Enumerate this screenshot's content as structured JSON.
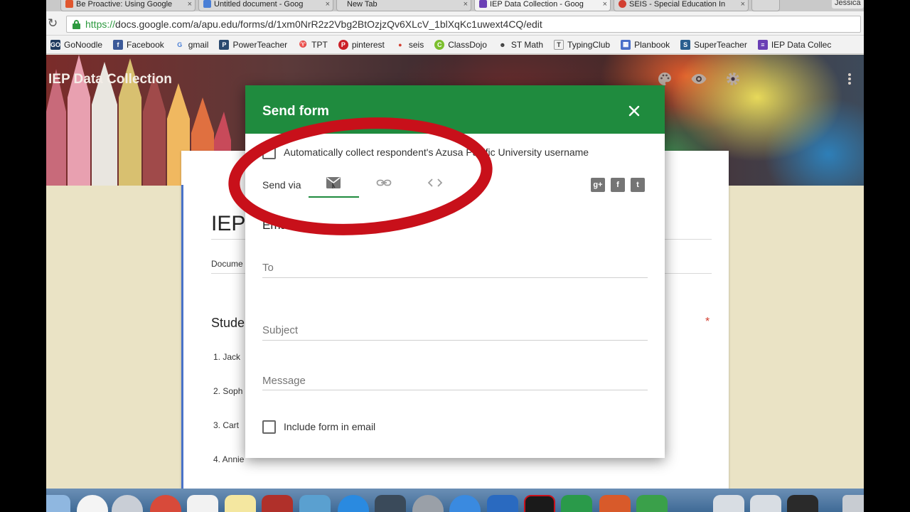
{
  "browser": {
    "tabs": [
      {
        "label": "Be Proactive: Using Google",
        "favicon_color": "#e0562e",
        "active": false
      },
      {
        "label": "Untitled document - Goog",
        "favicon_color": "#4a7fd6",
        "active": false
      },
      {
        "label": "New Tab",
        "favicon_color": "",
        "active": false
      },
      {
        "label": "IEP Data Collection - Goog",
        "favicon_color": "#6a3fb5",
        "active": true
      },
      {
        "label": "SEIS - Special Education In",
        "favicon_color": "#d23f31",
        "active": false
      }
    ],
    "tab_close_glyph": "×",
    "profile_name": "Jessica",
    "url_scheme": "https://",
    "url_rest": "docs.google.com/a/apu.edu/forms/d/1xm0NrR2z2Vbg2BtOzjzQv6XLcV_1blXqKc1uwext4CQ/edit",
    "bookmarks": [
      {
        "label": "GoNoodle",
        "icon_color": "#1f3a5f",
        "icon_text": "GO"
      },
      {
        "label": "Facebook",
        "icon_color": "#3b5998",
        "icon_text": "f"
      },
      {
        "label": "gmail",
        "icon_color": "#ffffff",
        "icon_text": "G"
      },
      {
        "label": "PowerTeacher",
        "icon_color": "#2b4a6f",
        "icon_text": "P"
      },
      {
        "label": "TPT",
        "icon_color": "#ffffff",
        "icon_text": "♈"
      },
      {
        "label": "pinterest",
        "icon_color": "#cb2027",
        "icon_text": "P"
      },
      {
        "label": "seis",
        "icon_color": "#d23f31",
        "icon_text": "●"
      },
      {
        "label": "ClassDojo",
        "icon_color": "#7cbf2e",
        "icon_text": "C"
      },
      {
        "label": "ST Math",
        "icon_color": "#333333",
        "icon_text": "☻"
      },
      {
        "label": "TypingClub",
        "icon_color": "#ffffff",
        "icon_text": "T"
      },
      {
        "label": "Planbook",
        "icon_color": "#4a6fc9",
        "icon_text": "▦"
      },
      {
        "label": "SuperTeacher",
        "icon_color": "#2a5f8f",
        "icon_text": "S"
      },
      {
        "label": "IEP Data Collec",
        "icon_color": "#6a3fb5",
        "icon_text": "≡"
      }
    ]
  },
  "form_page": {
    "header_title": "IEP Data Collection",
    "big_title": "IEP",
    "description": "Docume",
    "question_title": "Stude",
    "required_mark": "*",
    "items": [
      "1.   Jack",
      "2.   Soph",
      "3.   Cart",
      "4.   Annie"
    ],
    "icons": [
      "palette-icon",
      "eye-icon",
      "gear-icon",
      "more-vert-icon"
    ]
  },
  "dialog": {
    "title": "Send form",
    "close_glyph": "✕",
    "collect_label": "Automatically collect respondent's Azusa Pacific University username",
    "collect_checked": false,
    "send_via_label": "Send via",
    "send_tabs": [
      "email-icon",
      "link-icon",
      "embed-icon"
    ],
    "share_buttons": [
      {
        "name": "google-plus",
        "glyph": "g+"
      },
      {
        "name": "facebook",
        "glyph": "f"
      },
      {
        "name": "twitter",
        "glyph": "t"
      }
    ],
    "email_heading": "Email",
    "to_label": "To",
    "subject_label": "Subject",
    "message_label": "Message",
    "include_label": "Include form in email",
    "include_checked": false
  },
  "colors": {
    "dialog_header": "#1f8b3e",
    "annotation": "#c8101a",
    "form_accent": "#4a73c9"
  },
  "dock": {
    "icons": [
      "finder-icon",
      "itunes-icon",
      "launchpad-icon",
      "chrome-icon",
      "calendar-icon",
      "notes-icon",
      "photobooth-icon",
      "preview-icon",
      "app-store-icon",
      "contacts-icon",
      "system-preferences-icon",
      "safari-icon",
      "word-icon",
      "terminal-icon",
      "excel-icon",
      "powerpoint-icon",
      "numbers-icon",
      "folder-icon",
      "folder-icon",
      "trash-icon"
    ]
  }
}
